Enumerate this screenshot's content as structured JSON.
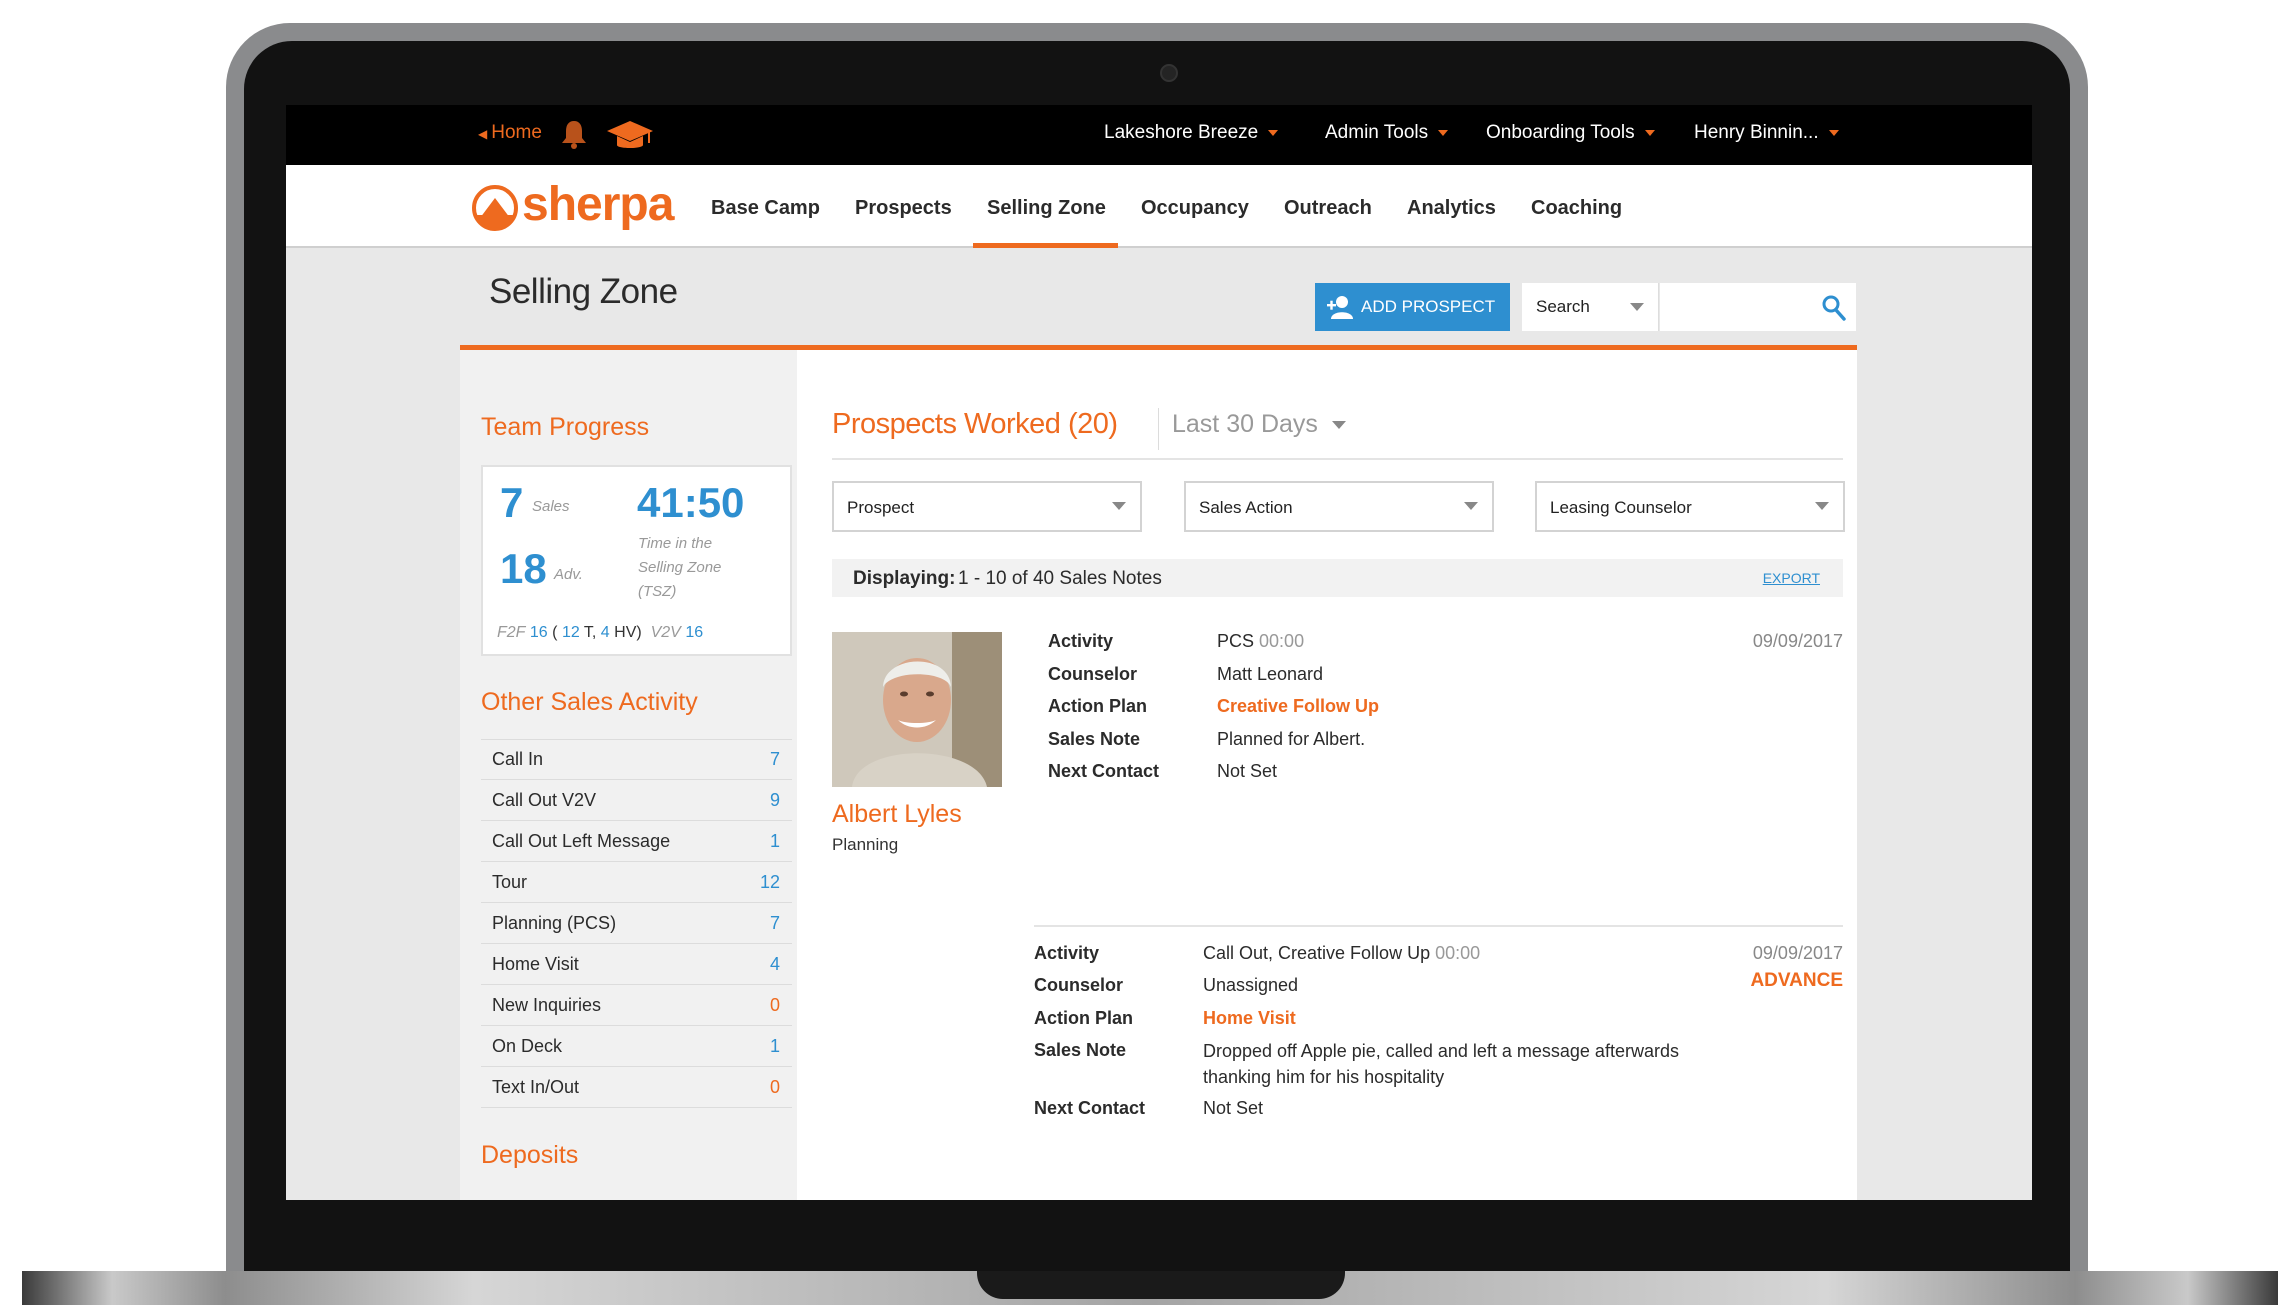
{
  "topbar": {
    "home_label": "Home",
    "menus": [
      {
        "label": "Lakeshore Breeze"
      },
      {
        "label": "Admin Tools"
      },
      {
        "label": "Onboarding Tools"
      },
      {
        "label": "Henry Binnin..."
      }
    ]
  },
  "brand": {
    "logo_text": "sherpa",
    "accent_color": "#ee6a1f",
    "link_color": "#2e8fd0"
  },
  "nav": {
    "items": [
      {
        "label": "Base Camp"
      },
      {
        "label": "Prospects"
      },
      {
        "label": "Selling Zone",
        "active": true
      },
      {
        "label": "Occupancy"
      },
      {
        "label": "Outreach"
      },
      {
        "label": "Analytics"
      },
      {
        "label": "Coaching"
      }
    ]
  },
  "page": {
    "title": "Selling Zone",
    "add_prospect_label": "ADD PROSPECT",
    "search_select": "Search",
    "search_value": ""
  },
  "team_progress": {
    "title": "Team Progress",
    "sales_count": "7",
    "sales_label": "Sales",
    "adv_count": "18",
    "adv_label": "Adv.",
    "tsz_time": "41:50",
    "tsz_label_1": "Time in the",
    "tsz_label_2": "Selling Zone",
    "tsz_label_3": "(TSZ)",
    "f2f_label": "F2F",
    "f2f_value": "16",
    "open_paren": "(",
    "t_value": "12",
    "t_label": "T,",
    "hv_value": "4",
    "hv_label": "HV)",
    "v2v_label": "V2V",
    "v2v_value": "16"
  },
  "other_sales_activity": {
    "title": "Other Sales Activity",
    "items": [
      {
        "label": "Call In",
        "count": "7",
        "color": "#2e8fd0"
      },
      {
        "label": "Call Out V2V",
        "count": "9",
        "color": "#2e8fd0"
      },
      {
        "label": "Call Out Left Message",
        "count": "1",
        "color": "#2e8fd0"
      },
      {
        "label": "Tour",
        "count": "12",
        "color": "#2e8fd0"
      },
      {
        "label": "Planning (PCS)",
        "count": "7",
        "color": "#2e8fd0"
      },
      {
        "label": "Home Visit",
        "count": "4",
        "color": "#2e8fd0"
      },
      {
        "label": "New Inquiries",
        "count": "0",
        "color": "#ee6a1f"
      },
      {
        "label": "On Deck",
        "count": "1",
        "color": "#2e8fd0"
      },
      {
        "label": "Text In/Out",
        "count": "0",
        "color": "#ee6a1f"
      }
    ]
  },
  "deposits": {
    "title": "Deposits"
  },
  "prospects_worked": {
    "title": "Prospects Worked (20)",
    "range": "Last 30 Days",
    "filters": [
      "Prospect",
      "Sales Action",
      "Leasing Counselor"
    ],
    "displaying_label": "Displaying:",
    "displaying_value": "1 - 10 of 40 Sales Notes",
    "export_label": "EXPORT"
  },
  "prospect": {
    "name": "Albert Lyles",
    "status": "Planning"
  },
  "notes": [
    {
      "labels": [
        "Activity",
        "Counselor",
        "Action Plan",
        "Sales Note",
        "Next Contact"
      ],
      "activity": "PCS",
      "time": "00:00",
      "counselor": "Matt Leonard",
      "action_plan": "Creative Follow Up",
      "sales_note": "Planned for Albert.",
      "next_contact": "Not Set",
      "date": "09/09/2017"
    },
    {
      "labels": [
        "Activity",
        "Counselor",
        "Action Plan",
        "Sales Note",
        "Next Contact"
      ],
      "activity": "Call Out, Creative Follow Up",
      "time": "00:00",
      "counselor": "Unassigned",
      "action_plan": "Home Visit",
      "sales_note": "Dropped off Apple pie, called and left a message afterwards thanking him for his hospitality",
      "next_contact": "Not Set",
      "date": "09/09/2017",
      "advance_label": "ADVANCE"
    }
  ]
}
